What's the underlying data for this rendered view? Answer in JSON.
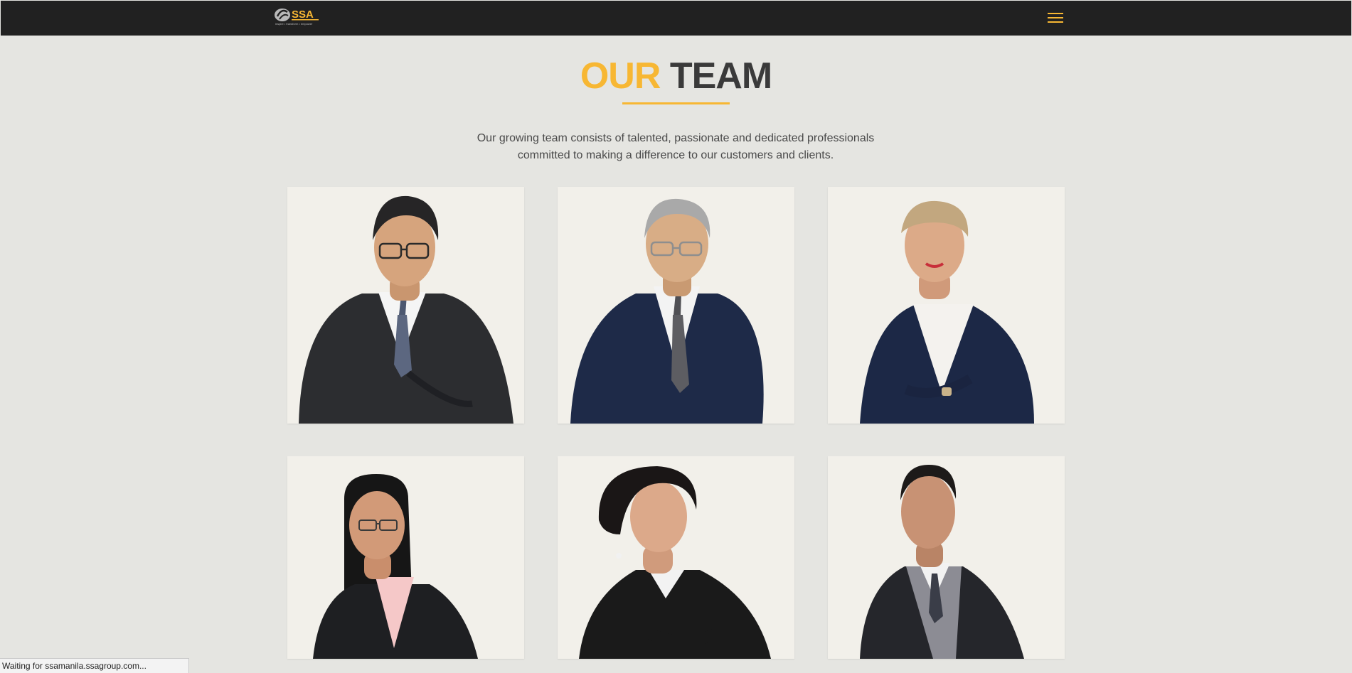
{
  "header": {
    "logo_text": "SSA",
    "logo_tagline": "inspire • transform • empower",
    "menu_icon": "hamburger-menu-icon",
    "accent_color": "#f7b733",
    "background_color": "#212121"
  },
  "section": {
    "title_accent": "OUR",
    "title_main": "TEAM",
    "description_line1": "Our growing team consists of talented, passionate and dedicated professionals",
    "description_line2": "committed to making a difference to our customers and clients."
  },
  "team": [
    {
      "name": "team-member-1",
      "gender": "male",
      "suit": "charcoal"
    },
    {
      "name": "team-member-2",
      "gender": "male",
      "suit": "navy"
    },
    {
      "name": "team-member-3",
      "gender": "female",
      "suit": "navy"
    },
    {
      "name": "team-member-4",
      "gender": "female",
      "suit": "black"
    },
    {
      "name": "team-member-5",
      "gender": "female",
      "suit": "black"
    },
    {
      "name": "team-member-6",
      "gender": "male",
      "suit": "charcoal"
    }
  ],
  "status_bar": {
    "text": "Waiting for ssamanila.ssagroup.com..."
  }
}
